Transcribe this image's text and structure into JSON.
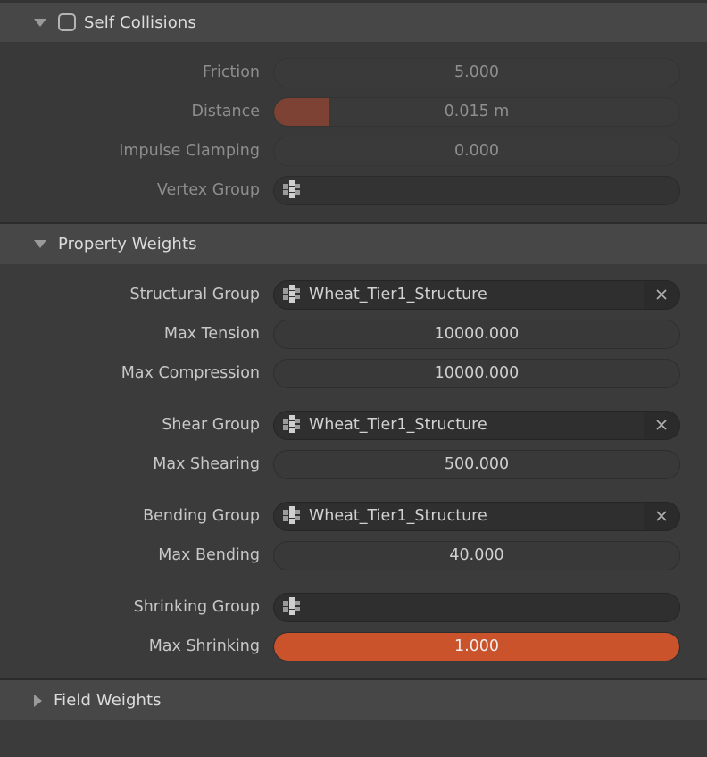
{
  "colors": {
    "accent_orange": "#cb532c",
    "slider_fill_muted": "#7d4233",
    "panel_bg": "#3b3b3b",
    "header_bg": "#474747",
    "field_bg": "#393939",
    "group_field_bg": "#2f2f2f",
    "text": "#d0d0d0",
    "text_dim": "#8f8f8f"
  },
  "self_collisions": {
    "title": "Self Collisions",
    "expanded": true,
    "checked": false,
    "disclosure_icon": "triangle-down-icon",
    "checkbox_icon": "checkbox-unchecked-icon",
    "rows": [
      {
        "label": "Friction",
        "value": "5.000",
        "type": "number"
      },
      {
        "label": "Distance",
        "value": "0.015 m",
        "type": "slider",
        "fill_percent": 13.5,
        "fill_color": "#7d4233"
      },
      {
        "label": "Impulse Clamping",
        "value": "0.000",
        "type": "number"
      },
      {
        "label": "Vertex Group",
        "value": "",
        "type": "group",
        "icon": "vertex-group-icon",
        "has_clear": false
      }
    ]
  },
  "property_weights": {
    "title": "Property Weights",
    "expanded": true,
    "disclosure_icon": "triangle-down-icon",
    "groups": [
      {
        "rows": [
          {
            "label": "Structural Group",
            "value": "Wheat_Tier1_Structure",
            "type": "group",
            "icon": "vertex-group-icon",
            "has_clear": true,
            "clear_icon": "close-x-icon"
          },
          {
            "label": "Max Tension",
            "value": "10000.000",
            "type": "number"
          },
          {
            "label": "Max Compression",
            "value": "10000.000",
            "type": "number"
          }
        ]
      },
      {
        "rows": [
          {
            "label": "Shear Group",
            "value": "Wheat_Tier1_Structure",
            "type": "group",
            "icon": "vertex-group-icon",
            "has_clear": true,
            "clear_icon": "close-x-icon"
          },
          {
            "label": "Max Shearing",
            "value": "500.000",
            "type": "number"
          }
        ]
      },
      {
        "rows": [
          {
            "label": "Bending Group",
            "value": "Wheat_Tier1_Structure",
            "type": "group",
            "icon": "vertex-group-icon",
            "has_clear": true,
            "clear_icon": "close-x-icon"
          },
          {
            "label": "Max Bending",
            "value": "40.000",
            "type": "number"
          }
        ]
      },
      {
        "rows": [
          {
            "label": "Shrinking Group",
            "value": "",
            "type": "group",
            "icon": "vertex-group-icon",
            "has_clear": false
          },
          {
            "label": "Max Shrinking",
            "value": "1.000",
            "type": "slider",
            "fill_percent": 100,
            "fill_color": "#cb532c"
          }
        ]
      }
    ]
  },
  "field_weights": {
    "title": "Field Weights",
    "expanded": false,
    "disclosure_icon": "triangle-right-icon"
  }
}
